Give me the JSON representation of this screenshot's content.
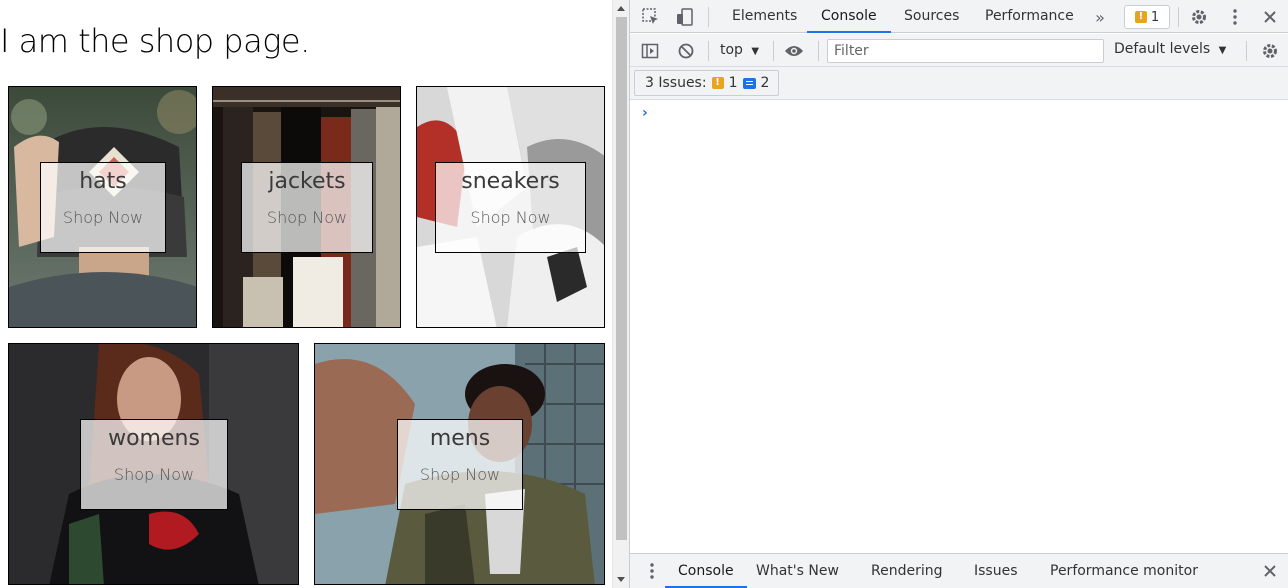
{
  "shop": {
    "page_title": "I am the shop page.",
    "tiles": [
      {
        "title": "hats",
        "cta": "Shop Now"
      },
      {
        "title": "jackets",
        "cta": "Shop Now"
      },
      {
        "title": "sneakers",
        "cta": "Shop Now"
      },
      {
        "title": "womens",
        "cta": "Shop Now"
      },
      {
        "title": "mens",
        "cta": "Shop Now"
      }
    ]
  },
  "devtools": {
    "tabs": [
      "Elements",
      "Console",
      "Sources",
      "Performance"
    ],
    "active_tab": "Console",
    "warning_count": "1",
    "console_toolbar": {
      "context": "top",
      "filter_placeholder": "Filter",
      "levels": "Default levels"
    },
    "issues": {
      "label": "3 Issues:",
      "warnings": "1",
      "messages": "2"
    },
    "drawer_tabs": [
      "Console",
      "What's New",
      "Rendering",
      "Issues",
      "Performance monitor"
    ],
    "active_drawer_tab": "Console"
  },
  "colors": {
    "accent": "#1a73e8",
    "warning": "#e8a41e"
  }
}
